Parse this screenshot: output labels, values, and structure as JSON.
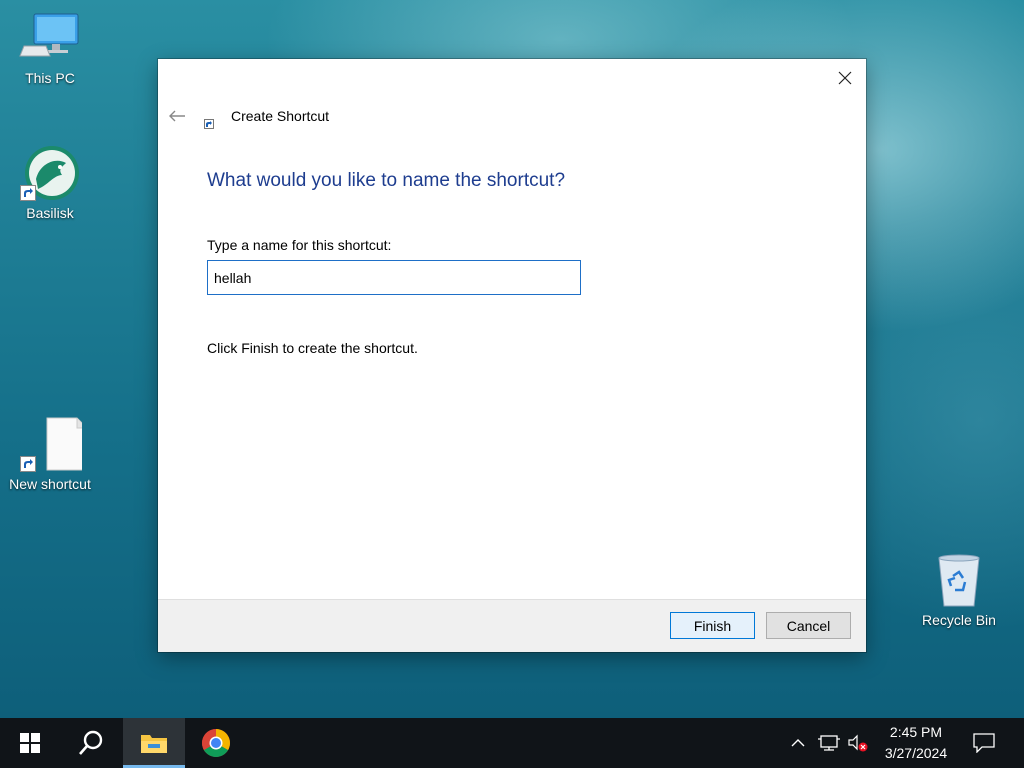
{
  "desktop": {
    "icons": [
      {
        "label": "This PC"
      },
      {
        "label": "Basilisk"
      },
      {
        "label": "New shortcut"
      },
      {
        "label": "Recycle Bin"
      }
    ]
  },
  "dialog": {
    "title": "Create Shortcut",
    "heading": "What would you like to name the shortcut?",
    "field_label": "Type a name for this shortcut:",
    "name_value": "hellah",
    "instruction": "Click Finish to create the shortcut.",
    "finish_label": "Finish",
    "cancel_label": "Cancel"
  },
  "taskbar": {
    "apps": [
      "start-icon",
      "search-icon",
      "file-explorer-icon",
      "chrome-icon"
    ],
    "tray_icons": [
      "chevron-up-icon",
      "network-icon",
      "volume-muted-icon"
    ],
    "time": "2:45 PM",
    "date": "3/27/2024"
  },
  "colors": {
    "heading": "#1e3d8f",
    "accent": "#0078d7",
    "taskbar": "#101418"
  }
}
